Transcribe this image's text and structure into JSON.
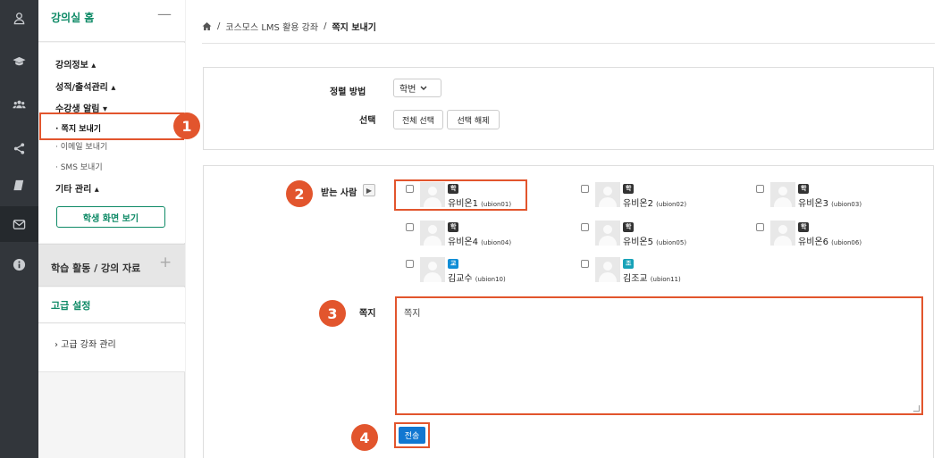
{
  "rail": {
    "icons": [
      "user-icon",
      "graduation-cap-icon",
      "users-icon",
      "share-icon",
      "book-icon",
      "mail-icon",
      "info-icon"
    ]
  },
  "sidebar": {
    "home_title": "강의실 홈",
    "home_collapse": "—",
    "menu": {
      "course_info": "강의정보 ▴",
      "grades": "성적/출석관리 ▴",
      "notify": "수강생 알림 ▾",
      "send_message": "· 쪽지 보내기",
      "send_email": "· 이메일 보내기",
      "send_sms": "· SMS 보내기",
      "other": "기타 관리 ▴",
      "student_view_button": "학생 화면 보기"
    },
    "activities_title": "학습 활동 / 강의 자료",
    "activities_expand": "+",
    "advanced_title": "고급 설정",
    "advanced_course": "›  고급 강좌 관리"
  },
  "breadcrumb": {
    "course": "코스모스 LMS 활용 강좌",
    "separator": "/",
    "current": "쪽지 보내기"
  },
  "form": {
    "sort_label": "정렬 방법",
    "sort_value": "학번",
    "select_label": "선택",
    "select_all": "전체 선택",
    "deselect": "선택 해제",
    "recipients_label": "받는 사람",
    "message_label": "쪽지",
    "message_value": "쪽지",
    "send_button": "전송"
  },
  "steps": [
    "1",
    "2",
    "3",
    "4"
  ],
  "recipients": [
    {
      "role": "학생",
      "name": "유비온1",
      "id": "(ubion01)"
    },
    {
      "role": "학생",
      "name": "유비온2",
      "id": "(ubion02)"
    },
    {
      "role": "학생",
      "name": "유비온3",
      "id": "(ubion03)"
    },
    {
      "role": "학생",
      "name": "유비온4",
      "id": "(ubion04)"
    },
    {
      "role": "학생",
      "name": "유비온5",
      "id": "(ubion05)"
    },
    {
      "role": "학생",
      "name": "유비온6",
      "id": "(ubion06)"
    },
    {
      "role": "교수자",
      "name": "김교수",
      "id": "(ubion10)"
    },
    {
      "role": "조교",
      "name": "김조교",
      "id": "(ubion11)"
    }
  ],
  "colors": {
    "accent_green": "#0e8a66",
    "highlight_orange": "#e2552d",
    "primary_blue": "#1177d1",
    "rail_bg": "#32363b"
  }
}
